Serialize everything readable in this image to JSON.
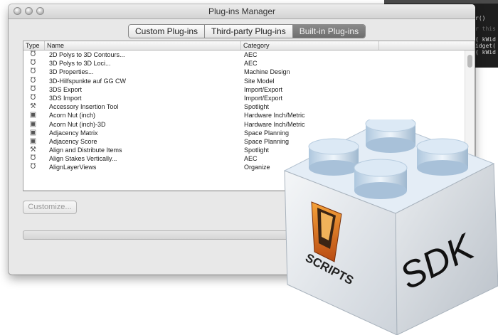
{
  "window": {
    "title": "Plug-ins Manager"
  },
  "tabs": [
    {
      "label": "Custom Plug-ins",
      "active": false
    },
    {
      "label": "Third-party Plug-ins",
      "active": false
    },
    {
      "label": "Built-in Plug-ins",
      "active": true
    }
  ],
  "table": {
    "columns": {
      "type": "Type",
      "name": "Name",
      "category": "Category"
    },
    "rows": [
      {
        "icon": "script-icon",
        "name": "2D Polys to 3D Contours...",
        "category": "AEC"
      },
      {
        "icon": "script-icon",
        "name": "3D Polys to 3D Loci...",
        "category": "AEC"
      },
      {
        "icon": "script-icon",
        "name": "3D Properties...",
        "category": "Machine Design"
      },
      {
        "icon": "script-icon",
        "name": "3D-Hilfspunkte auf GG CW",
        "category": "Site Model"
      },
      {
        "icon": "script-icon",
        "name": "3DS Export",
        "category": "Import/Export"
      },
      {
        "icon": "script-icon",
        "name": "3DS Import",
        "category": "Import/Export"
      },
      {
        "icon": "wrench-icon",
        "name": "Accessory Insertion Tool",
        "category": "Spotlight"
      },
      {
        "icon": "object-icon",
        "name": "Acorn Nut (inch)",
        "category": "Hardware Inch/Metric"
      },
      {
        "icon": "object-icon",
        "name": "Acorn Nut (inch)-3D",
        "category": "Hardware Inch/Metric"
      },
      {
        "icon": "object-icon",
        "name": "Adjacency Matrix",
        "category": "Space Planning"
      },
      {
        "icon": "object-icon",
        "name": "Adjacency Score",
        "category": "Space Planning"
      },
      {
        "icon": "wrench-icon",
        "name": "Align and Distribute Items",
        "category": "Spotlight"
      },
      {
        "icon": "script-icon",
        "name": "Align Stakes Vertically...",
        "category": "AEC"
      },
      {
        "icon": "script-icon",
        "name": "AlignLayerViews",
        "category": "Organize"
      }
    ]
  },
  "buttons": {
    "customize": "Customize..."
  },
  "code_snippet": {
    "lines": [
      "r()",
      "r this",
      "( kWid",
      "idget(",
      "( kWid"
    ]
  },
  "logo": {
    "scripts_text": "SCRIPTS",
    "sdk_text": "SDK"
  },
  "colors": {
    "selected_tab": "#787878",
    "sdk_cube_top": "#dbe9f6",
    "logo_orange": "#e0761f"
  }
}
